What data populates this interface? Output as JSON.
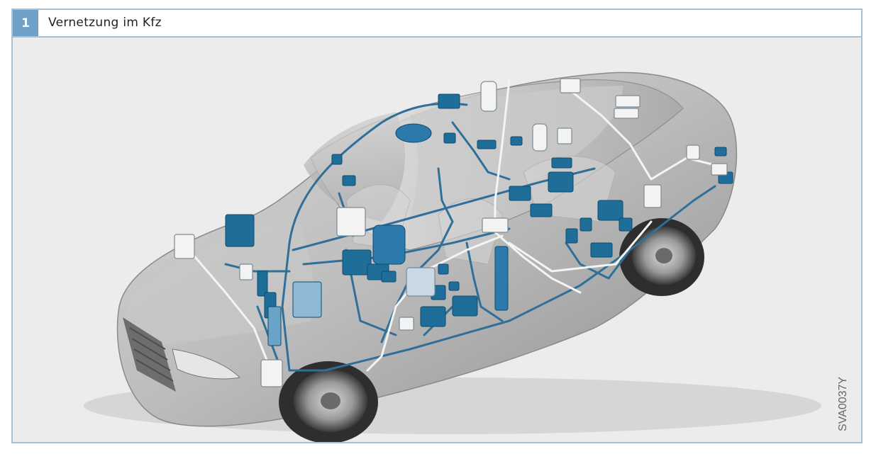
{
  "figure": {
    "number": "1",
    "title": "Vernetzung im Kfz",
    "image_code": "SVA0037Y"
  },
  "colors": {
    "accent": "#6fa0c7",
    "frame": "#a9bfd2",
    "wire_blue": "#2f6f99",
    "module_blue": "#1f6d99",
    "module_white": "#f3f3f3",
    "car_body": "#b9b9b9"
  }
}
